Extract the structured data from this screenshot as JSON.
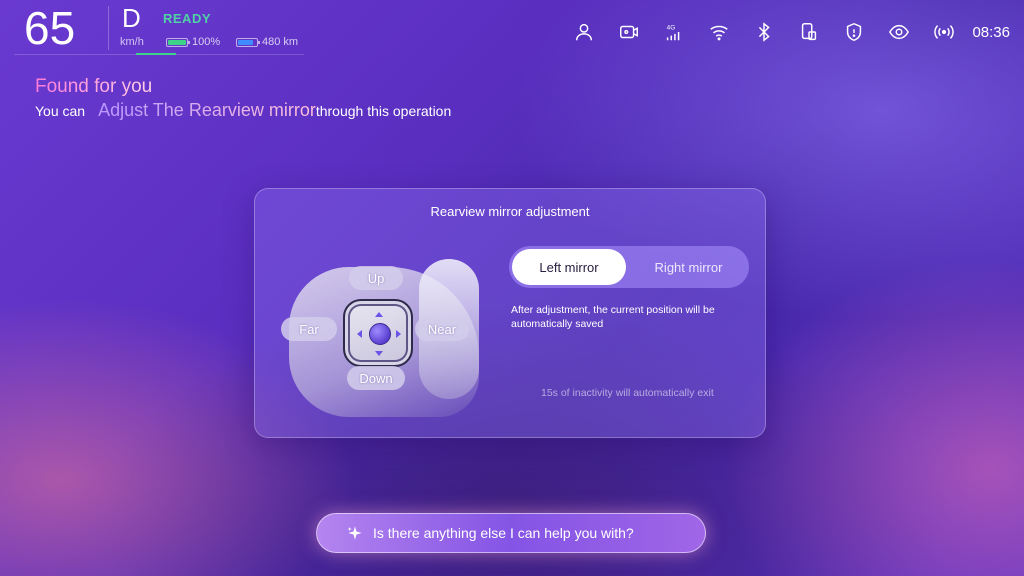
{
  "status": {
    "speed": "65",
    "gear": "D",
    "unit": "km/h",
    "ready": "READY",
    "battery_percent_label": "100%",
    "battery_fill_fraction": 1.0,
    "range_label": "480 km",
    "range_fill_fraction": 0.85,
    "icons": [
      "user-icon",
      "camera-icon",
      "signal-4g-icon",
      "wifi-icon",
      "bluetooth-icon",
      "phone-device-icon",
      "shield-icon",
      "eye-icon",
      "broadcast-icon"
    ],
    "signal_label": "4G",
    "time": "08:36"
  },
  "found": {
    "title": "Found for you",
    "prefix": "You can",
    "highlight": "Adjust The Rearview mirror",
    "suffix": "through this operation"
  },
  "card": {
    "title": "Rearview mirror adjustment",
    "directions": {
      "up": "Up",
      "down": "Down",
      "far": "Far",
      "near": "Near"
    },
    "toggle": {
      "left": "Left mirror",
      "right": "Right mirror",
      "selected": "Left mirror"
    },
    "note": "After adjustment, the current position will be automatically saved",
    "exit_note": "15s of inactivity will automatically exit"
  },
  "assistant": {
    "prompt": "Is there anything else I can help you with?",
    "icon": "sparkle-icon"
  },
  "colors": {
    "ready": "#4fd1a5",
    "battery": "#3fd38a",
    "range": "#3f8bff",
    "accent_pink": "#ff7ad9"
  }
}
